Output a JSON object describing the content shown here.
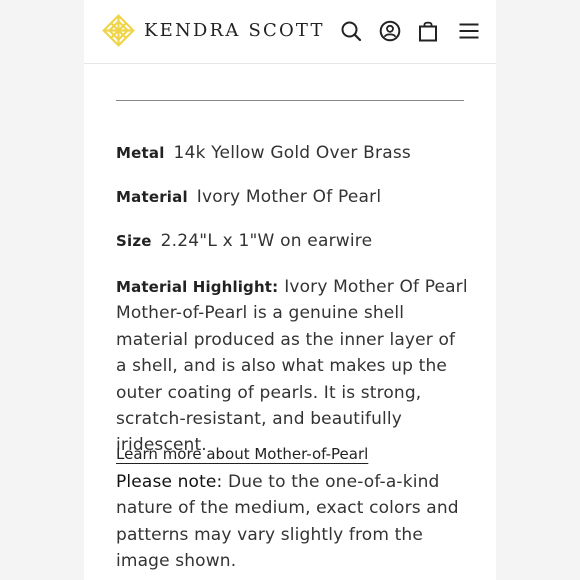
{
  "header": {
    "brand": "KENDRA SCOTT",
    "brand_color": "#f0d447",
    "icons": [
      "search-icon",
      "account-icon",
      "bag-icon",
      "menu-icon"
    ]
  },
  "specs": [
    {
      "label": "Metal",
      "value": "14k Yellow Gold Over Brass"
    },
    {
      "label": "Material",
      "value": "Ivory Mother Of Pearl"
    },
    {
      "label": "Size",
      "value": "2.24\"L x 1\"W on earwire"
    }
  ],
  "highlight": {
    "label": "Material Highlight:",
    "title": "Ivory Mother Of Pearl",
    "description": "Mother-of-Pearl is a genuine shell material produced as the inner layer of a shell, and is also what makes up the outer coating of pearls. It is strong, scratch-resistant, and beautifully iridescent."
  },
  "learn_more": "Learn more about Mother-of-Pearl",
  "note": {
    "label": "Please note:",
    "text": "Due to the one-of-a-kind nature of the medium, exact colors and patterns may vary slightly from the image shown."
  }
}
